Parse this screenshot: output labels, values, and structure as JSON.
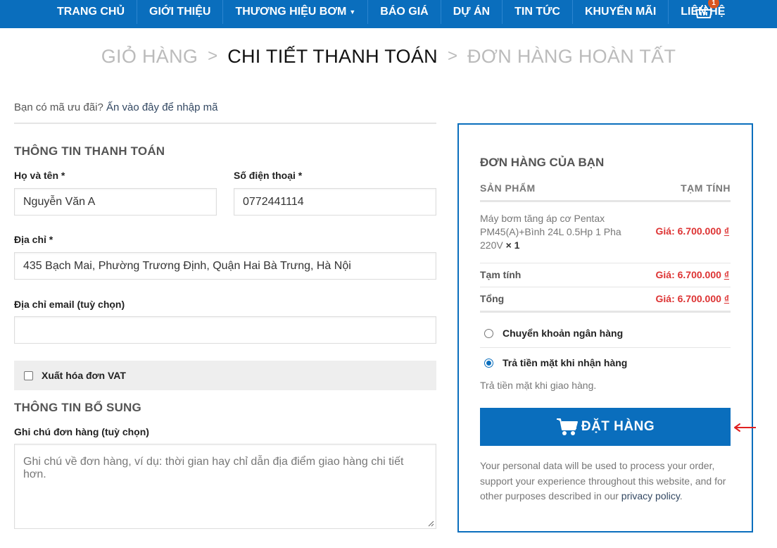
{
  "nav": {
    "items": [
      {
        "label": "TRANG CHỦ"
      },
      {
        "label": "GIỚI THIỆU"
      },
      {
        "label": "THƯƠNG HIỆU BƠM"
      },
      {
        "label": "BÁO GIÁ"
      },
      {
        "label": "DỰ ÁN"
      },
      {
        "label": "TIN TỨC"
      },
      {
        "label": "KHUYẾN MÃI"
      },
      {
        "label": "LIÊN HỆ"
      }
    ],
    "cart_count": "1",
    "cart_icon": "basket-icon",
    "brand_color": "#0a6ebd"
  },
  "steps": {
    "cart": "GIỎ HÀNG",
    "checkout": "CHI TIẾT THANH TOÁN",
    "complete": "ĐƠN HÀNG HOÀN TẤT",
    "separator": ">"
  },
  "coupon": {
    "question": "Bạn có mã ưu đãi?",
    "link": "Ấn vào đây để nhập mã"
  },
  "billing": {
    "title": "THÔNG TIN THANH TOÁN",
    "name_label": "Họ và tên *",
    "name_value": "Nguyễn Văn A",
    "phone_label": "Số điện thoại *",
    "phone_value": "0772441114",
    "address_label": "Địa chỉ *",
    "address_value": "435 Bạch Mai, Phường Trương Định, Quận Hai Bà Trưng, Hà Nội",
    "email_label": "Địa chỉ email (tuỳ chọn)",
    "email_value": "",
    "vat_label": "Xuất hóa đơn VAT"
  },
  "additional": {
    "title": "THÔNG TIN BỔ SUNG",
    "notes_label": "Ghi chú đơn hàng (tuỳ chọn)",
    "notes_placeholder": "Ghi chú về đơn hàng, ví dụ: thời gian hay chỉ dẫn địa điểm giao hàng chi tiết hơn."
  },
  "order": {
    "title": "ĐƠN HÀNG CỦA BẠN",
    "col_product": "SẢN PHẨM",
    "col_subtotal": "TẠM TÍNH",
    "product_name": "Máy bơm tăng áp cơ Pentax PM45(A)+Bình 24L 0.5Hp 1 Pha 220V",
    "product_qty": "× 1",
    "price_prefix": "Giá: ",
    "product_price": "6.700.000",
    "currency": "₫",
    "subtotal_label": "Tạm tính",
    "subtotal_value": "6.700.000",
    "total_label": "Tổng",
    "total_value": "6.700.000",
    "price_color": "#dd3333"
  },
  "payment": {
    "bank_label": "Chuyển khoản ngân hàng",
    "cod_label": "Trả tiền mặt khi nhận hàng",
    "cod_description": "Trả tiền mặt khi giao hàng.",
    "selected": "cod"
  },
  "place_order": {
    "label": "ĐẶT HÀNG",
    "icon": "cart-icon"
  },
  "privacy": {
    "text": "Your personal data will be used to process your order, support your experience throughout this website, and for other purposes described in our",
    "link": "privacy policy",
    "end": "."
  },
  "annotation": {
    "arrow_color": "#e02020"
  }
}
